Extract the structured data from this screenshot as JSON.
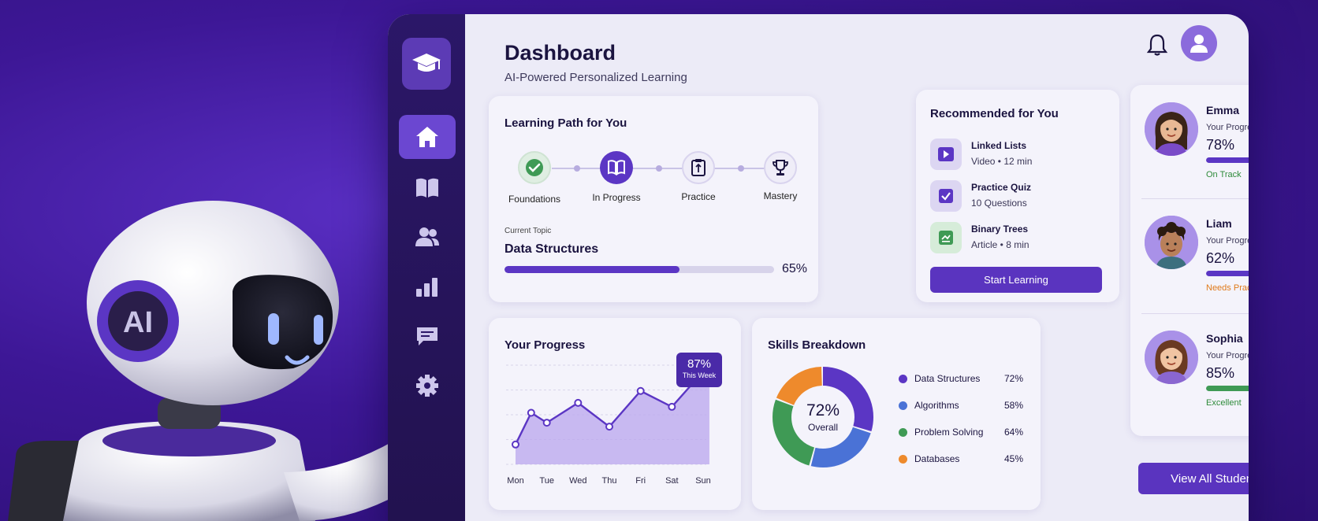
{
  "header": {
    "title": "Dashboard",
    "subtitle": "AI-Powered Personalized Learning"
  },
  "robot": {
    "badge": "AI"
  },
  "sidebar": {
    "items": [
      {
        "icon": "home-icon",
        "active": true
      },
      {
        "icon": "book-icon",
        "active": false
      },
      {
        "icon": "users-icon",
        "active": false
      },
      {
        "icon": "bar-chart-icon",
        "active": false
      },
      {
        "icon": "message-icon",
        "active": false
      },
      {
        "icon": "gear-icon",
        "active": false
      }
    ]
  },
  "learning_path": {
    "title": "Learning Path for You",
    "steps": [
      {
        "label": "Foundations",
        "state": "done"
      },
      {
        "label": "In Progress",
        "state": "current"
      },
      {
        "label": "Practice",
        "state": "upcoming"
      },
      {
        "label": "Mastery",
        "state": "upcoming"
      }
    ],
    "current_topic_label": "Current Topic",
    "current_topic": "Data Structures",
    "progress": 0.65,
    "progress_text": "65%"
  },
  "recommended": {
    "title": "Recommended for You",
    "items": [
      {
        "name": "Linked Lists",
        "meta": "Video • 12 min",
        "icon": "play-icon"
      },
      {
        "name": "Practice Quiz",
        "meta": "10 Questions",
        "icon": "checkbox-icon"
      },
      {
        "name": "Binary Trees",
        "meta": "Article • 8 min",
        "icon": "article-icon"
      }
    ],
    "button": "Start Learning"
  },
  "students": {
    "progress_label": "Your Progress",
    "items": [
      {
        "name": "Emma",
        "pct_text": "78%",
        "progress": 0.78,
        "status": "On Track",
        "status_color": "#2e8b3a"
      },
      {
        "name": "Liam",
        "pct_text": "62%",
        "progress": 0.62,
        "status": "Needs Practice",
        "status_color": "#e07a1a"
      },
      {
        "name": "Sophia",
        "pct_text": "85%",
        "progress": 0.85,
        "status": "Excellent",
        "status_color": "#2e8b3a"
      }
    ],
    "button": "View All Students"
  },
  "progress_chart": {
    "title": "Your Progress",
    "tooltip_value": "87%",
    "tooltip_label": "This Week"
  },
  "skills": {
    "title": "Skills Breakdown",
    "center_value": "72%",
    "center_label": "Overall",
    "items": [
      {
        "name": "Data Structures",
        "value_text": "72%",
        "color": "#5b36c4"
      },
      {
        "name": "Algorithms",
        "value_text": "58%",
        "color": "#4a72d6"
      },
      {
        "name": "Problem Solving",
        "value_text": "64%",
        "color": "#3f9a55"
      },
      {
        "name": "Databases",
        "value_text": "45%",
        "color": "#ee8a2c"
      }
    ]
  },
  "chart_data": [
    {
      "type": "area",
      "title": "Your Progress",
      "categories": [
        "Mon",
        "Tue",
        "Wed",
        "Thu",
        "Fri",
        "Sat",
        "Sun"
      ],
      "values": [
        20,
        52,
        42,
        62,
        38,
        74,
        58,
        90,
        83
      ],
      "x_positions": [
        0,
        0.5,
        1,
        2,
        3,
        4,
        5,
        5.9,
        6.2
      ],
      "highlight": {
        "label": "87%",
        "sublabel": "This Week"
      },
      "ylim": [
        0,
        100
      ],
      "grid": true
    },
    {
      "type": "pie",
      "title": "Skills Breakdown",
      "labels": [
        "Data Structures",
        "Algorithms",
        "Problem Solving",
        "Databases"
      ],
      "values": [
        72,
        58,
        64,
        45
      ],
      "center": "72%"
    }
  ]
}
